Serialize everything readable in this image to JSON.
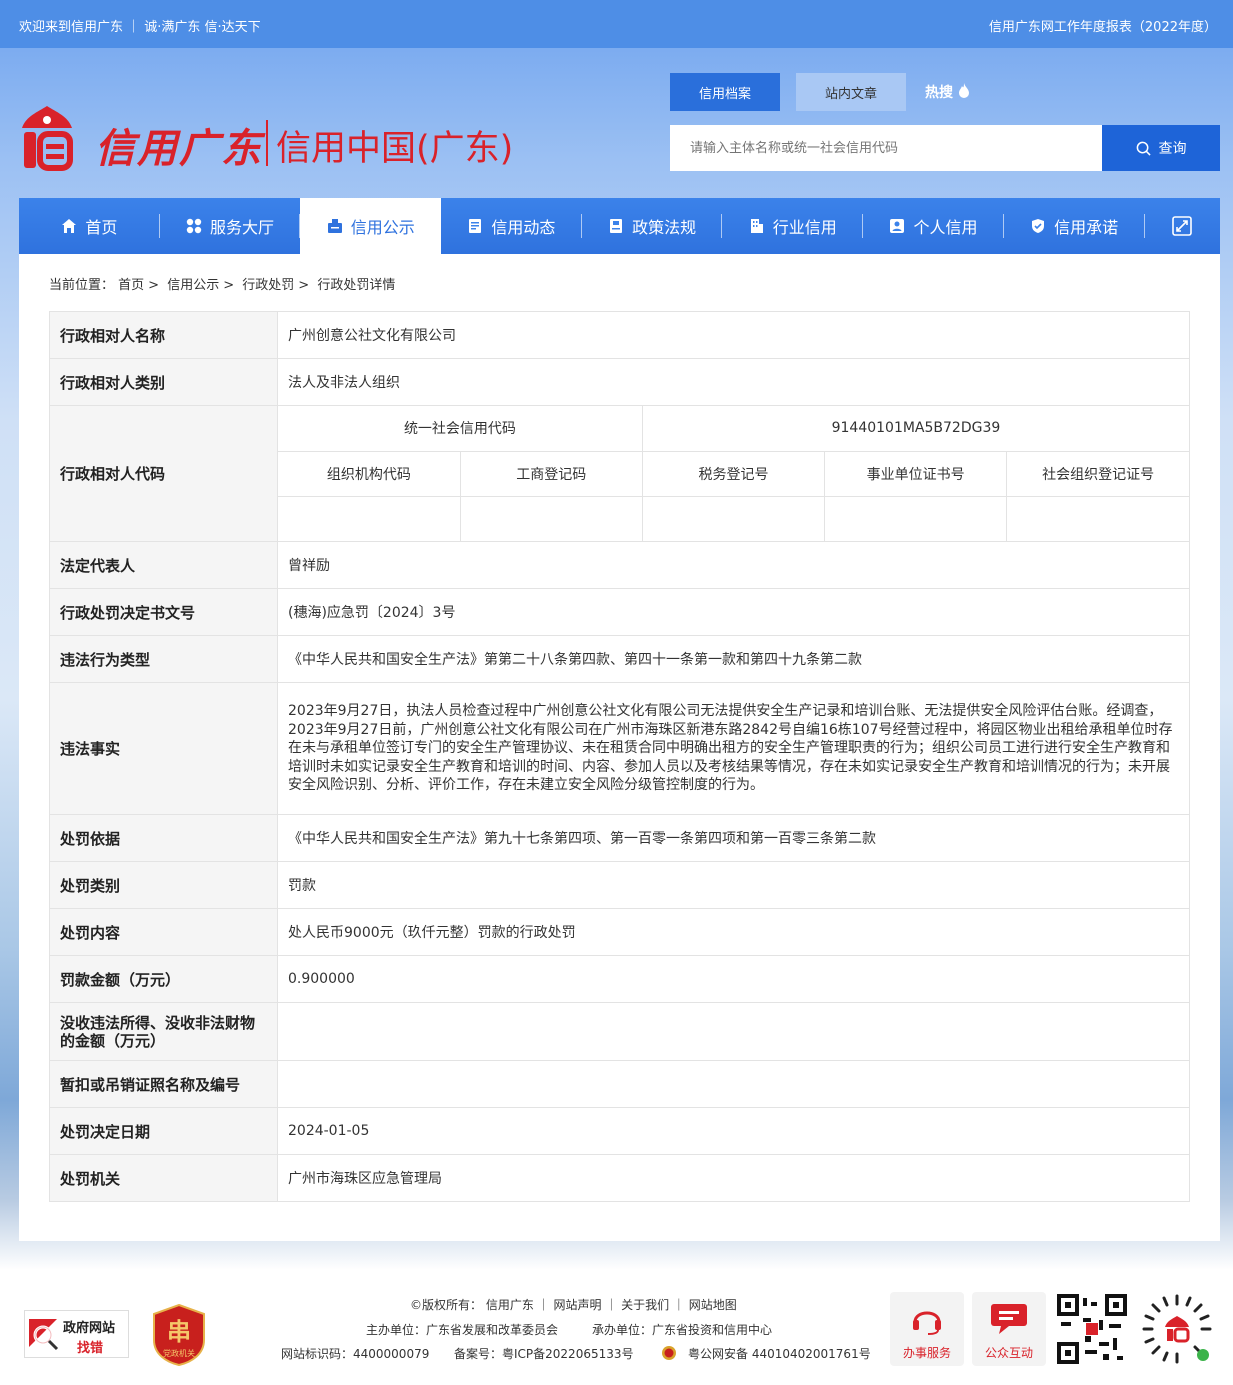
{
  "topbar": {
    "welcome": "欢迎来到信用广东 ｜ 诚·满广东  信·达天下",
    "report": "信用广东网工作年度报表（2022年度）"
  },
  "logo": {
    "name": "信用广东",
    "subtitle": "信用中国(广东)"
  },
  "search": {
    "tabs": [
      "信用档案",
      "站内文章"
    ],
    "hot": "热搜",
    "placeholder": "请输入主体名称或统一社会信用代码",
    "button": "查询"
  },
  "nav": {
    "items": [
      {
        "label": "首页",
        "icon": "home-icon"
      },
      {
        "label": "服务大厅",
        "icon": "grid-icon"
      },
      {
        "label": "信用公示",
        "icon": "notice-icon"
      },
      {
        "label": "信用动态",
        "icon": "news-icon"
      },
      {
        "label": "政策法规",
        "icon": "policy-icon"
      },
      {
        "label": "行业信用",
        "icon": "building-icon"
      },
      {
        "label": "个人信用",
        "icon": "person-icon"
      },
      {
        "label": "信用承诺",
        "icon": "shield-icon"
      }
    ],
    "active_index": 2
  },
  "breadcrumb": {
    "prefix": "当前位置：",
    "items": [
      "首页",
      "信用公示",
      "行政处罚",
      "行政处罚详情"
    ]
  },
  "detail": {
    "name_label": "行政相对人名称",
    "name_value": "广州创意公社文化有限公司",
    "type_label": "行政相对人类别",
    "type_value": "法人及非法人组织",
    "code_label": "行政相对人代码",
    "uscc_label": "统一社会信用代码",
    "uscc_value": "91440101MA5B72DG39",
    "code_headers": [
      "组织机构代码",
      "工商登记码",
      "税务登记号",
      "事业单位证书号",
      "社会组织登记证号"
    ],
    "code_values": [
      "",
      "",
      "",
      "",
      ""
    ],
    "legal_label": "法定代表人",
    "legal_value": "曾祥励",
    "doc_label": "行政处罚决定书文号",
    "doc_value": "(穗海)应急罚〔2024〕3号",
    "violation_type_label": "违法行为类型",
    "violation_type_value": "《中华人民共和国安全生产法》第第二十八条第四款、第四十一条第一款和第四十九条第二款",
    "facts_label": "违法事实",
    "facts_value": "2023年9月27日，执法人员检查过程中广州创意公社文化有限公司无法提供安全生产记录和培训台账、无法提供安全风险评估台账。经调查，2023年9月27日前，广州创意公社文化有限公司在广州市海珠区新港东路2842号自编16栋107号经营过程中，将园区物业出租给承租单位时存在未与承租单位签订专门的安全生产管理协议、未在租赁合同中明确出租方的安全生产管理职责的行为；组织公司员工进行进行安全生产教育和培训时未如实记录安全生产教育和培训的时间、内容、参加人员以及考核结果等情况，存在未如实记录安全生产教育和培训情况的行为；未开展安全风险识别、分析、评价工作，存在未建立安全风险分级管控制度的行为。",
    "basis_label": "处罚依据",
    "basis_value": "《中华人民共和国安全生产法》第九十七条第四项、第一百零一条第四项和第一百零三条第二款",
    "category_label": "处罚类别",
    "category_value": "罚款",
    "content_label": "处罚内容",
    "content_value": "处人民币9000元（玖仟元整）罚款的行政处罚",
    "fine_label": "罚款金额（万元）",
    "fine_value": "0.900000",
    "confiscate_label": "没收违法所得、没收非法财物的金额（万元）",
    "confiscate_value": "",
    "license_label": "暂扣或吊销证照名称及编号",
    "license_value": "",
    "date_label": "处罚决定日期",
    "date_value": "2024-01-05",
    "authority_label": "处罚机关",
    "authority_value": "广州市海珠区应急管理局"
  },
  "footer": {
    "line1": "©版权所有： 信用广东 ｜ 网站声明 ｜ 关于我们 ｜ 网站地图",
    "sponsor": "主办单位：广东省发展和改革委员会",
    "organizer": "承办单位：广东省投资和信用中心",
    "site_id": "网站标识码：4400000079",
    "icp": "备案号：粤ICP备2022065133号",
    "police": "粤公网安备 44010402001761号",
    "gov_site_1": "政府网站",
    "gov_site_2": "找错",
    "party_badge": "党政机关",
    "service": "办事服务",
    "interaction": "公众互动"
  },
  "colors": {
    "primary": "#2f72de",
    "brand_red": "#d9222a"
  }
}
